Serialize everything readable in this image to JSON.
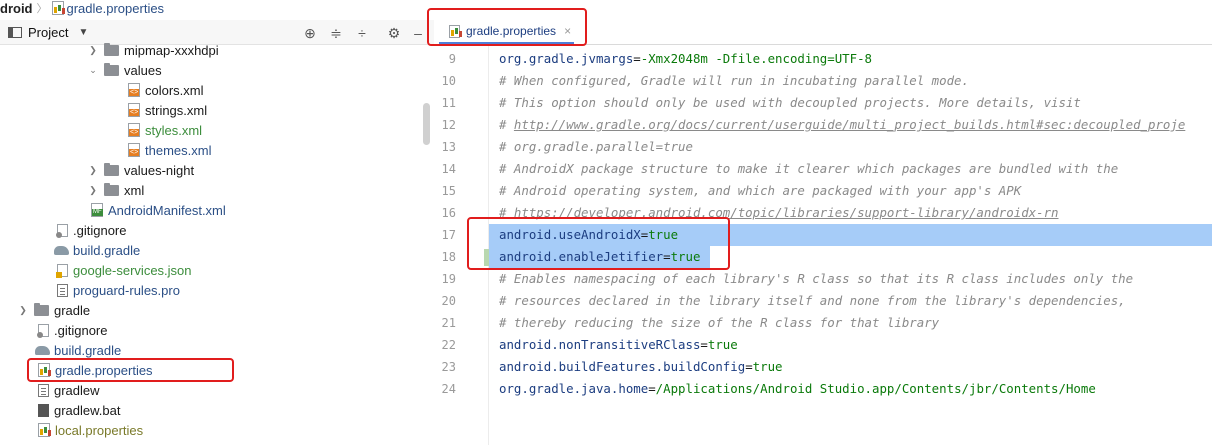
{
  "breadcrumb": {
    "project": "droid",
    "file": "gradle.properties"
  },
  "project_panel": {
    "label": "Project",
    "dropdown": "▼"
  },
  "toolbar_icons": [
    "crosshair-icon",
    "expand-all-icon",
    "collapse-all-icon",
    "gear-icon",
    "minimize-icon"
  ],
  "editor_tab": {
    "label": "gradle.properties",
    "close": "×"
  },
  "tree": [
    {
      "label": "mipmap-xxxhdpi",
      "indent": 0
    },
    {
      "label": "values"
    },
    {
      "label": "colors.xml"
    },
    {
      "label": "strings.xml"
    },
    {
      "label": "styles.xml"
    },
    {
      "label": "themes.xml"
    },
    {
      "label": "values-night"
    },
    {
      "label": "xml"
    },
    {
      "label": "AndroidManifest.xml"
    },
    {
      "label": ".gitignore"
    },
    {
      "label": "build.gradle"
    },
    {
      "label": "google-services.json"
    },
    {
      "label": "proguard-rules.pro"
    },
    {
      "label": "gradle"
    },
    {
      "label": ".gitignore"
    },
    {
      "label": "build.gradle"
    },
    {
      "label": "gradle.properties"
    },
    {
      "label": "gradlew"
    },
    {
      "label": "gradlew.bat"
    },
    {
      "label": "local.properties"
    }
  ],
  "line_numbers": [
    "9",
    "10",
    "11",
    "12",
    "13",
    "14",
    "15",
    "16",
    "17",
    "18",
    "19",
    "20",
    "21",
    "22",
    "23",
    "24"
  ],
  "code": {
    "l9_key": "org.gradle.jvmargs",
    "l9_val": "-Xmx2048m -Dfile.encoding=UTF-8",
    "l10": "# When configured, Gradle will run in incubating parallel mode.",
    "l11": "# This option should only be used with decoupled projects. More details, visit",
    "l12_hash": "# ",
    "l12_link": "http://www.gradle.org/docs/current/userguide/multi_project_builds.html#sec:decoupled_proje",
    "l13": "# org.gradle.parallel=true",
    "l14": "# AndroidX package structure to make it clearer which packages are bundled with the",
    "l15": "# Android operating system, and which are packaged with your app's APK",
    "l16_hash": "# ",
    "l16_link": "https://developer.android.com/topic/libraries/support-library/androidx-rn",
    "l17_key": "android.useAndroidX",
    "l17_val": "true",
    "l18_key": "android.enableJetifier",
    "l18_val": "true",
    "l19": "# Enables namespacing of each library's R class so that its R class includes only the",
    "l20": "# resources declared in the library itself and none from the library's dependencies,",
    "l21": "# thereby reducing the size of the R class for that library",
    "l22_key": "android.nonTransitiveRClass",
    "l22_val": "true",
    "l23_key": "android.buildFeatures.buildConfig",
    "l23_val": "true",
    "l24_key": "org.gradle.java.home",
    "l24_val": "/Applications/Android Studio.app/Contents/jbr/Contents/Home",
    "eq": "="
  },
  "colors": {
    "annotation": "#e11d1d",
    "selection": "#a6ccf8",
    "tab_underline": "#4f7fd9"
  }
}
